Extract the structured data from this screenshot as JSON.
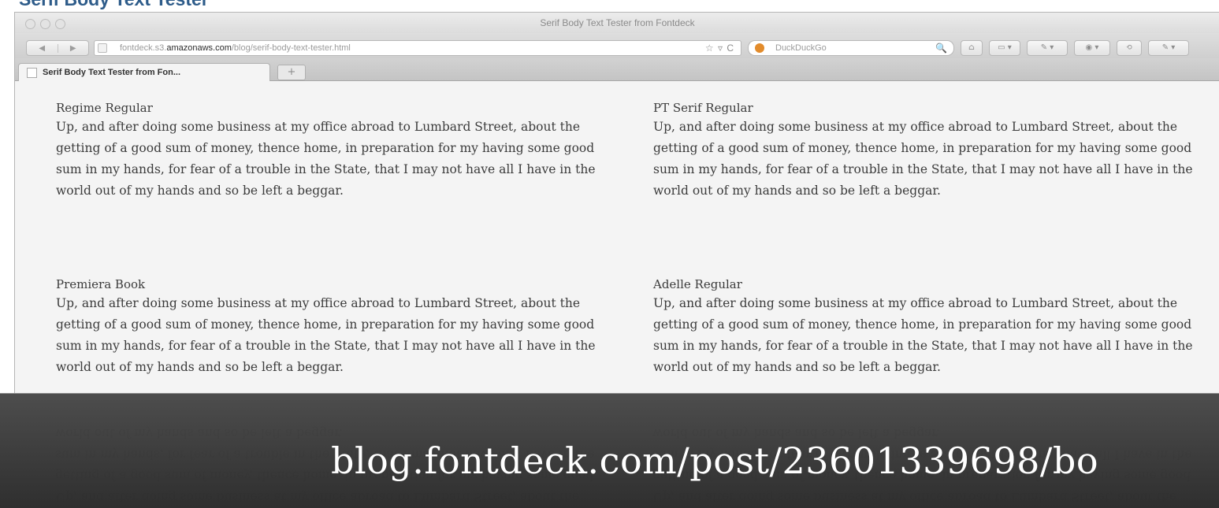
{
  "page_heading": "Serif Body Text Tester",
  "browser": {
    "window_title": "Serif Body Text Tester from Fontdeck",
    "nav_back": "◀",
    "nav_forward": "▶",
    "url_prefix": "fontdeck.s3.",
    "url_domain": "amazonaws.com",
    "url_path": "/blog/serif-body-text-tester.html",
    "url_actions": "☆ ▿ C",
    "search_placeholder": "DuckDuckGo",
    "search_icon": "🔍",
    "toolbar_icons": [
      "⌂",
      "▭ ▾",
      "✎ ▾",
      "◉ ▾",
      "⟲",
      "✎ ▾"
    ],
    "tab_label": "Serif Body Text Tester from Fon...",
    "newtab_label": "+"
  },
  "samples": [
    {
      "font": "Regime Regular",
      "text": "Up, and after doing some business at my office abroad to Lumbard Street, about the getting of a good sum of money, thence home, in preparation for my having some good sum in my hands, for fear of a trouble in the State, that I may not have all I have in the world out of my hands and so be left a beggar."
    },
    {
      "font": "PT Serif Regular",
      "text": "Up, and after doing some business at my office abroad to Lumbard Street, about the getting of a good sum of money, thence home, in preparation for my having some good sum in my hands, for fear of a trouble in the State, that I may not have all I have in the world out of my hands and so be left a beggar."
    },
    {
      "font": "Premiera Book",
      "text": "Up, and after doing some business at my office abroad to Lumbard Street, about the getting of a good sum of money, thence home, in preparation for my having some good sum in my hands, for fear of a trouble in the State, that I may not have all I have in the world out of my hands and so be left a beggar."
    },
    {
      "font": "Adelle Regular",
      "text": "Up, and after doing some business at my office abroad to Lumbard Street, about the getting of a good sum of money, thence home, in preparation for my having some good sum in my hands, for fear of a trouble in the State, that I may not have all I have in the world out of my hands and so be left a beggar."
    }
  ],
  "caption": "blog.fontdeck.com/post/23601339698/bo",
  "colors": {
    "heading": "#2e5c8a",
    "body_text": "#3b3b3b",
    "overlay": "#3a3a3a",
    "caption": "#ffffff"
  }
}
